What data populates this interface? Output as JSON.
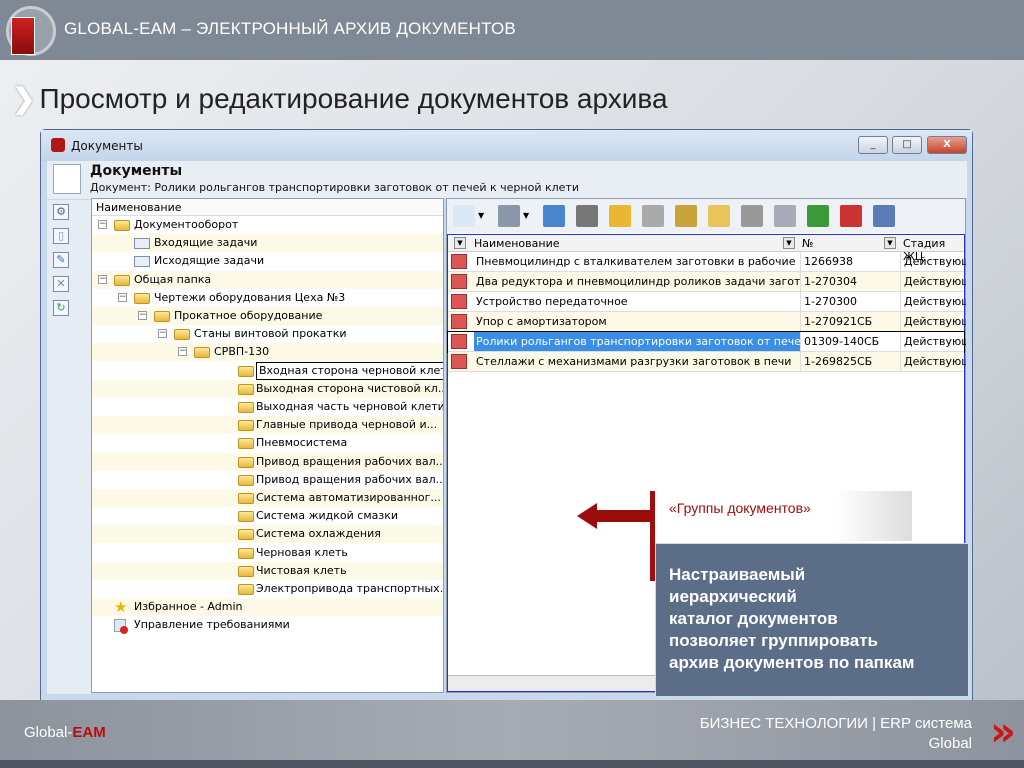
{
  "header": {
    "title": "GLOBAL-EAM – ЭЛЕКТРОННЫЙ АРХИВ ДОКУМЕНТОВ"
  },
  "page_title": "Просмотр и редактирование документов архива",
  "window": {
    "title": "Документы",
    "buttons": [
      "_",
      "□",
      "X"
    ],
    "header_title": "Документы",
    "header_subtitle": "Документ: Ролики рольгангов транспортировки заготовок от печей к черной клети"
  },
  "tree": {
    "column": "Наименование",
    "items": [
      {
        "label": "Документооборот",
        "level": 0,
        "icon": "folder",
        "expander": true
      },
      {
        "label": "Входящие задачи",
        "level": 1,
        "icon": "incoming-mail"
      },
      {
        "label": "Исходящие задачи",
        "level": 1,
        "icon": "outgoing-mail"
      },
      {
        "label": "Общая папка",
        "level": 0,
        "icon": "folder",
        "expander": true
      },
      {
        "label": "Чертежи оборудования Цеха №3",
        "level": 1,
        "icon": "folder",
        "expander": true
      },
      {
        "label": "Прокатное оборудование",
        "level": 2,
        "icon": "folder",
        "expander": true
      },
      {
        "label": "Станы винтовой прокатки",
        "level": 3,
        "icon": "folder",
        "expander": true
      },
      {
        "label": "СРВП-130",
        "level": 4,
        "icon": "folder",
        "expander": true
      },
      {
        "label": "Входная сторона черновой клети",
        "level": 5,
        "icon": "folder",
        "selected": true
      },
      {
        "label": "Выходная сторона чистовой кл...",
        "level": 5,
        "icon": "folder"
      },
      {
        "label": "Выходная часть черновой клети",
        "level": 5,
        "icon": "folder"
      },
      {
        "label": "Главные привода  черновой и...",
        "level": 5,
        "icon": "folder"
      },
      {
        "label": "Пневмосистема",
        "level": 5,
        "icon": "folder"
      },
      {
        "label": "Привод вращения рабочих вал...",
        "level": 5,
        "icon": "folder"
      },
      {
        "label": "Привод вращения рабочих вал...",
        "level": 5,
        "icon": "folder"
      },
      {
        "label": "Система  автоматизированног...",
        "level": 5,
        "icon": "folder"
      },
      {
        "label": "Система жидкой смазки",
        "level": 5,
        "icon": "folder"
      },
      {
        "label": "Система охлаждения",
        "level": 5,
        "icon": "folder"
      },
      {
        "label": "Черновая клеть",
        "level": 5,
        "icon": "folder"
      },
      {
        "label": "Чистовая клеть",
        "level": 5,
        "icon": "folder"
      },
      {
        "label": "Электропривода  транспортных...",
        "level": 5,
        "icon": "folder"
      },
      {
        "label": "Избранное - Admin",
        "level": 0,
        "icon": "star"
      },
      {
        "label": "Управление требованиями",
        "level": 0,
        "icon": "requirements"
      }
    ]
  },
  "toolbar": {
    "icons": [
      "new-document-icon",
      "tools-icon",
      "edit-icon",
      "trash-icon",
      "lock-icon",
      "cancel-icon",
      "link-icon",
      "open-folder-icon",
      "delete-icon",
      "save-icon",
      "refresh-icon",
      "checklist-icon",
      "exit-icon"
    ]
  },
  "grid": {
    "columns": [
      "Наименование",
      "№",
      "Стадия ЖЦ"
    ],
    "rows": [
      {
        "name": "Пневмоцилиндр с вталкивателем заготовки в рабочие в...",
        "num": "1266938",
        "stage": "Действующ"
      },
      {
        "name": "Два редуктора и пневмоцилиндр роликов задачи загото...",
        "num": "1-270304",
        "stage": "Действующ"
      },
      {
        "name": "Устройство передаточное",
        "num": "1-270300",
        "stage": "Действующи"
      },
      {
        "name": "Упор с амортизатором",
        "num": "1-270921СБ",
        "stage": "Действующ"
      },
      {
        "name": "Ролики рольгангов транспортировки заготовок от печей...",
        "num": "01309-140СБ",
        "stage": "Действующ",
        "selected": true
      },
      {
        "name": "Стеллажи с механизмами разгрузки заготовок в печи",
        "num": "1-269825СБ",
        "stage": "Действующ"
      }
    ],
    "scroll_label": "III"
  },
  "callout": {
    "label": "«Группы документов»",
    "text": [
      "Настраиваемый",
      "иерархический",
      "каталог документов",
      "позволяет группировать",
      "архив документов по папкам"
    ]
  },
  "footer": {
    "left_prefix": "Global-",
    "left_accent": "EAM",
    "right_line1": "БИЗНЕС ТЕХНОЛОГИИ | ERP система",
    "right_line2": "Global",
    "chevrons": "»"
  },
  "colors": {
    "accent": "#b50d0d",
    "callout_bg": "#5b6d87",
    "selection": "#3b8ee6"
  }
}
